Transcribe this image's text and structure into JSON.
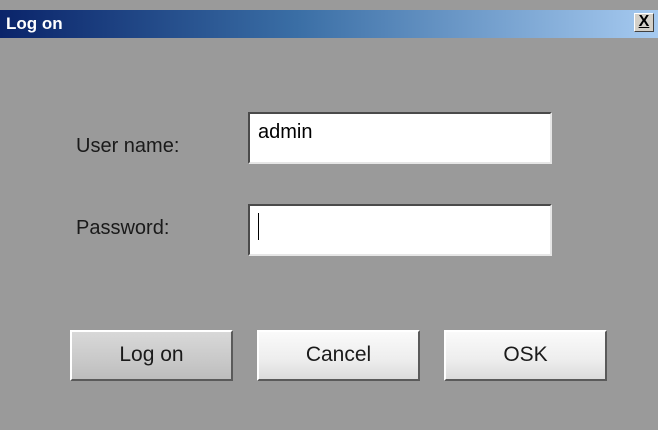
{
  "window": {
    "title": "Log on",
    "close_label": "X"
  },
  "form": {
    "username_label": "User name:",
    "username_value": "admin",
    "password_label": "Password:",
    "password_value": ""
  },
  "buttons": {
    "logon_label": "Log on",
    "cancel_label": "Cancel",
    "osk_label": "OSK"
  }
}
